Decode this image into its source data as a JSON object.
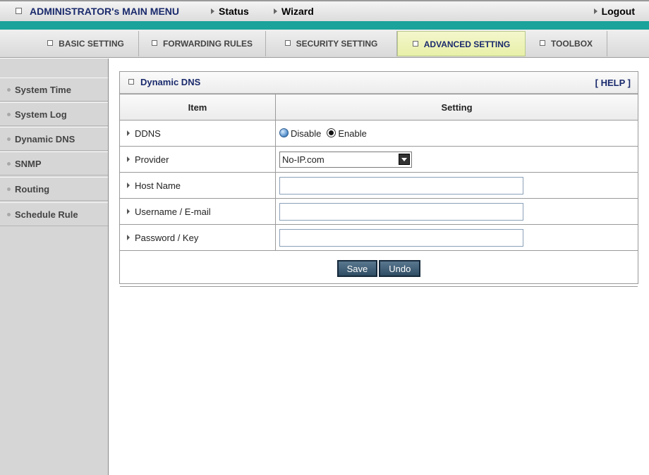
{
  "topbar": {
    "main_menu": "ADMINISTRATOR's MAIN MENU",
    "status": "Status",
    "wizard": "Wizard",
    "logout": "Logout"
  },
  "tabs": [
    {
      "label": "BASIC SETTING",
      "active": false
    },
    {
      "label": "FORWARDING RULES",
      "active": false
    },
    {
      "label": "SECURITY SETTING",
      "active": false
    },
    {
      "label": "ADVANCED SETTING",
      "active": true
    },
    {
      "label": "TOOLBOX",
      "active": false
    }
  ],
  "sidebar": {
    "items": [
      {
        "label": "System Time"
      },
      {
        "label": "System Log"
      },
      {
        "label": "Dynamic DNS"
      },
      {
        "label": "SNMP"
      },
      {
        "label": "Routing"
      },
      {
        "label": "Schedule Rule"
      }
    ]
  },
  "panel": {
    "title": "Dynamic DNS",
    "help": "[ HELP ]",
    "col_item": "Item",
    "col_setting": "Setting",
    "ddns_label": "DDNS",
    "ddns_disable": "Disable",
    "ddns_enable": "Enable",
    "ddns_selected": "Enable",
    "provider_label": "Provider",
    "provider_value": "No-IP.com",
    "host_label": "Host Name",
    "host_value": "",
    "user_label": "Username / E-mail",
    "user_value": "",
    "pass_label": "Password / Key",
    "pass_value": "",
    "save_label": "Save",
    "undo_label": "Undo"
  },
  "colors": {
    "teal_bar": "#1aa39b",
    "title_text": "#1a2a6c",
    "sidebar_bg": "#d6d6d6",
    "active_tab_bg": "#eef3b8",
    "button_bg": "#3b5a70"
  },
  "icons": {
    "menu_square": "square-bullet-icon",
    "nav_arrow": "triangle-right-icon",
    "sidebar_dot": "dot-bullet-icon",
    "dropdown": "chevron-down-icon"
  }
}
